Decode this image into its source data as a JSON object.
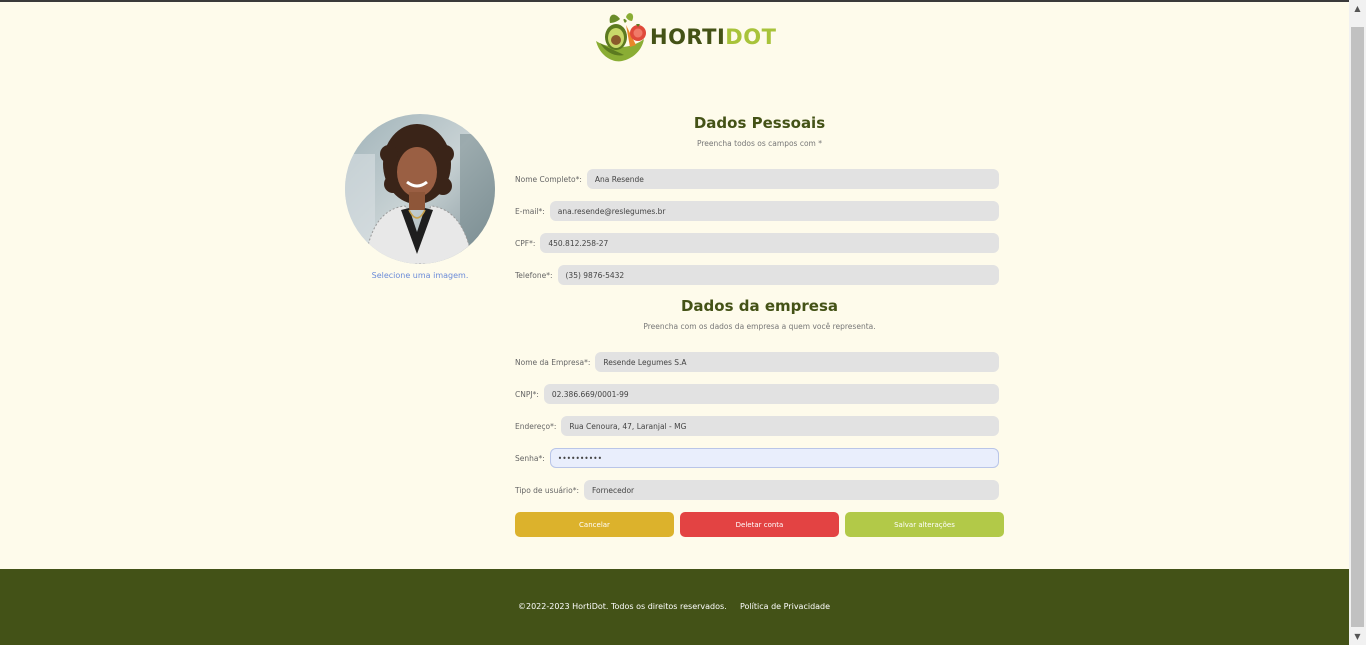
{
  "brand": {
    "name_part1": "HORTI",
    "name_part2": "DOT",
    "color_dark": "#445216",
    "color_light": "#a8c33a"
  },
  "avatar": {
    "select_label": "Selecione uma imagem."
  },
  "personal": {
    "title": "Dados Pessoais",
    "subtitle": "Preencha todos os campos com *",
    "fields": [
      {
        "label": "Nome Completo*:",
        "value": "Ana Resende"
      },
      {
        "label": "E-mail*:",
        "value": "ana.resende@reslegumes.br"
      },
      {
        "label": "CPF*:",
        "value": "450.812.258-27"
      },
      {
        "label": "Telefone*:",
        "value": "(35) 9876-5432"
      }
    ]
  },
  "company": {
    "title": "Dados da empresa",
    "subtitle": "Preencha com os dados da empresa a quem você representa.",
    "fields": [
      {
        "label": "Nome da Empresa*:",
        "value": "Resende Legumes S.A"
      },
      {
        "label": "CNPJ*:",
        "value": "02.386.669/0001-99"
      },
      {
        "label": "Endereço*:",
        "value": "Rua Cenoura, 47,  Laranjal - MG"
      },
      {
        "label": "Senha*:",
        "value": "••••••••••"
      },
      {
        "label": "Tipo de usuário*:",
        "value": "Fornecedor"
      }
    ]
  },
  "buttons": {
    "cancel": "Cancelar",
    "delete": "Deletar conta",
    "save": "Salvar alterações",
    "cancel_color": "#dcb22c",
    "delete_color": "#e34343",
    "save_color": "#b2c948"
  },
  "footer": {
    "copyright": "©2022-2023 HortiDot. Todos os direitos reservados.",
    "privacy": "Política de Privacidade",
    "background": "#435217"
  }
}
